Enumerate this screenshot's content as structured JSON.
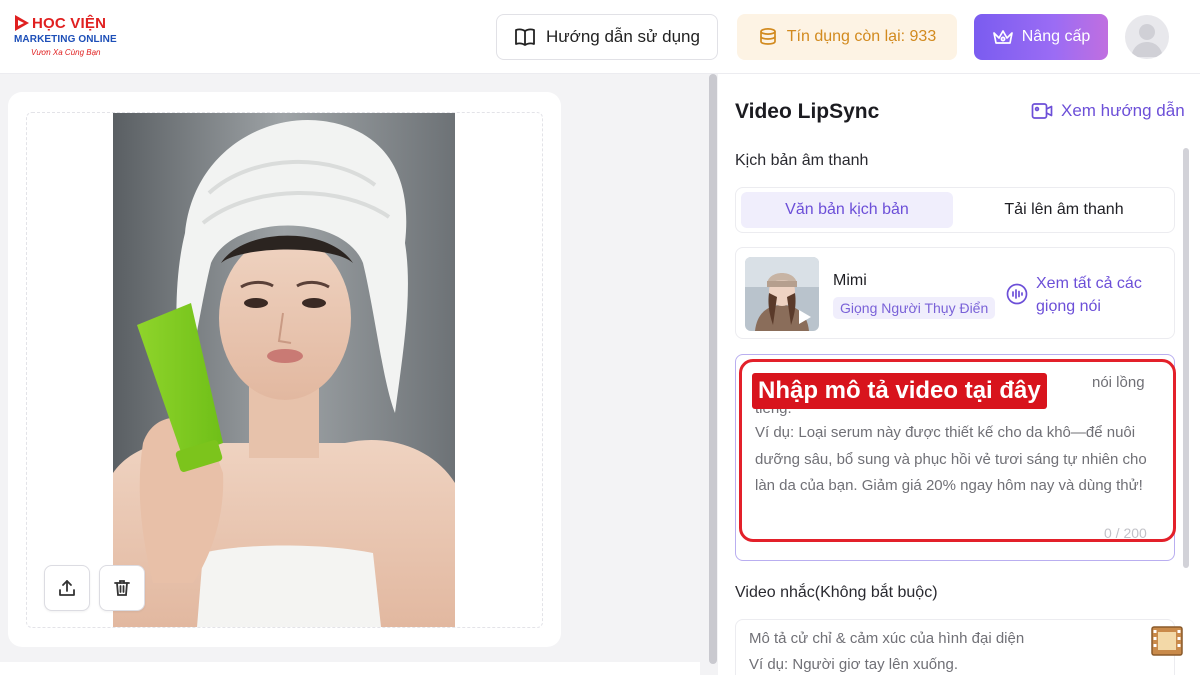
{
  "header": {
    "logo": {
      "line1": "HỌC VIỆN",
      "line2": "MARKETING ONLINE",
      "line3": "Vươn Xa Cùng Bạn"
    },
    "guide_button": "Hướng dẫn sử dụng",
    "credits_label": "Tín dụng còn lại: 933",
    "upgrade_button": "Nâng cấp"
  },
  "panel": {
    "title": "Video LipSync",
    "help_link": "Xem hướng dẫn",
    "audio_script_label": "Kịch bản âm thanh",
    "tabs": [
      {
        "label": "Văn bản kịch bản",
        "active": true
      },
      {
        "label": "Tải lên âm thanh",
        "active": false
      }
    ],
    "voice": {
      "name": "Mimi",
      "tag": "Giọng Người Thụy Điển",
      "view_all": "Xem tất cả các giọng nói"
    },
    "script": {
      "overlay": "Nhập mô tả video tại đây",
      "peek_top_right": "nói lồng",
      "peek_second_line": "tiếng.",
      "example": "Ví dụ: Loại serum này được thiết kế cho da khô—để nuôi dưỡng sâu, bổ sung và phục hồi vẻ tươi sáng tự nhiên cho làn da của bạn. Giảm giá 20% ngay hôm nay và dùng thử!",
      "counter": "0 / 200"
    },
    "motion_label": "Video nhắc(Không bắt buộc)",
    "motion_placeholder_line1": "Mô tả cử chỉ & cảm xúc của hình đại diện",
    "motion_placeholder_line2": "Ví dụ: Người giơ tay lên xuống."
  },
  "colors": {
    "accent": "#6c4fd8",
    "credits_text": "#d28a1e",
    "credits_bg": "#fdf3e4",
    "highlight_red": "#e3202a"
  },
  "icons": {
    "guide": "book-open-icon",
    "credits": "coins-stack-icon",
    "upgrade": "crown-icon",
    "help": "video-camera-icon",
    "voices": "audio-wave-icon",
    "upload": "upload-icon",
    "delete": "trash-icon",
    "film": "film-strip-icon"
  }
}
